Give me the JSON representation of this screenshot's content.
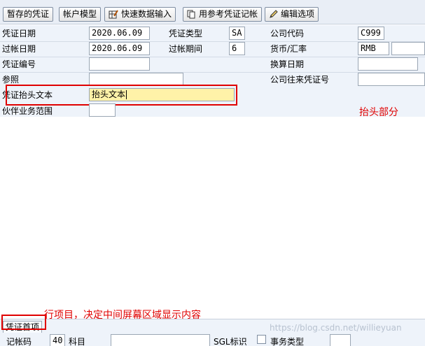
{
  "toolbar": {
    "buttons": [
      {
        "label": "暂存的凭证",
        "icon": "none"
      },
      {
        "label": "帐户模型",
        "icon": "none"
      },
      {
        "label": "快速数据输入",
        "icon": "pencil-grid-icon"
      },
      {
        "label": "用参考凭证记帐",
        "icon": "copy-document-icon"
      },
      {
        "label": "编辑选项",
        "icon": "pencil-icon"
      }
    ]
  },
  "header": {
    "doc_date_label": "凭证日期",
    "doc_date_value": "2020.06.09",
    "doc_type_label": "凭证类型",
    "doc_type_value": "SA",
    "company_code_label": "公司代码",
    "company_code_value": "C999",
    "posting_date_label": "过帐日期",
    "posting_date_value": "2020.06.09",
    "period_label": "过帐期间",
    "period_value": "6",
    "currency_label": "货币/汇率",
    "currency_value": "RMB",
    "rate_value": "",
    "doc_number_label": "凭证编号",
    "doc_number_value": "",
    "translation_date_label": "换算日期",
    "translation_date_value": "",
    "reference_label": "参照",
    "reference_value": "",
    "intercompany_label": "公司往来凭证号",
    "intercompany_value": "",
    "header_text_label": "凭证抬头文本",
    "header_text_value": "抬头文本",
    "partner_area_label": "伙伴业务范围",
    "partner_area_value": ""
  },
  "annotations": {
    "header_note": "抬头部分",
    "line_item_note": "行项目，决定中间屏幕区域显示内容"
  },
  "bottom": {
    "tab_label": "凭证首项",
    "posting_key_label": "记帐码",
    "posting_key_value": "40",
    "account_label": "科目",
    "account_value": "",
    "sgl_label": "SGL标识",
    "transaction_type_label": "事务类型",
    "transaction_type_value": ""
  },
  "watermark": "https://blog.csdn.net/willieyuan",
  "colors": {
    "annotation_red": "#e00000",
    "highlight_yellow": "#fff2a8",
    "form_background": "#eef3fa"
  }
}
